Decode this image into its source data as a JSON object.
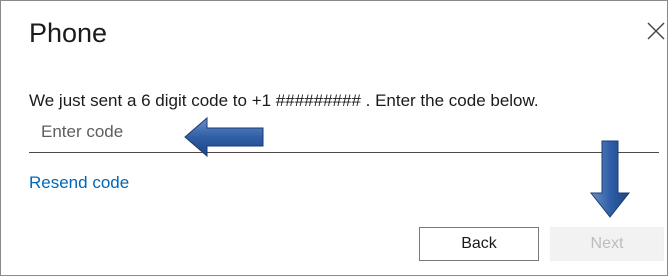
{
  "dialog": {
    "title": "Phone",
    "close_icon": "close-icon",
    "message": "We just sent a 6 digit code to +1 ######### . Enter the code below.",
    "code_input": {
      "placeholder": "Enter code",
      "value": ""
    },
    "resend_label": "Resend code",
    "back_label": "Back",
    "next_label": "Next",
    "next_enabled": false
  },
  "annotations": {
    "left_arrow_icon": "arrow-left-icon",
    "down_arrow_icon": "arrow-down-icon",
    "arrow_color": "#2f5fa6"
  },
  "colors": {
    "link": "#0067b8",
    "text": "#1b1b1b",
    "disabled_text": "#bdbdbd"
  }
}
